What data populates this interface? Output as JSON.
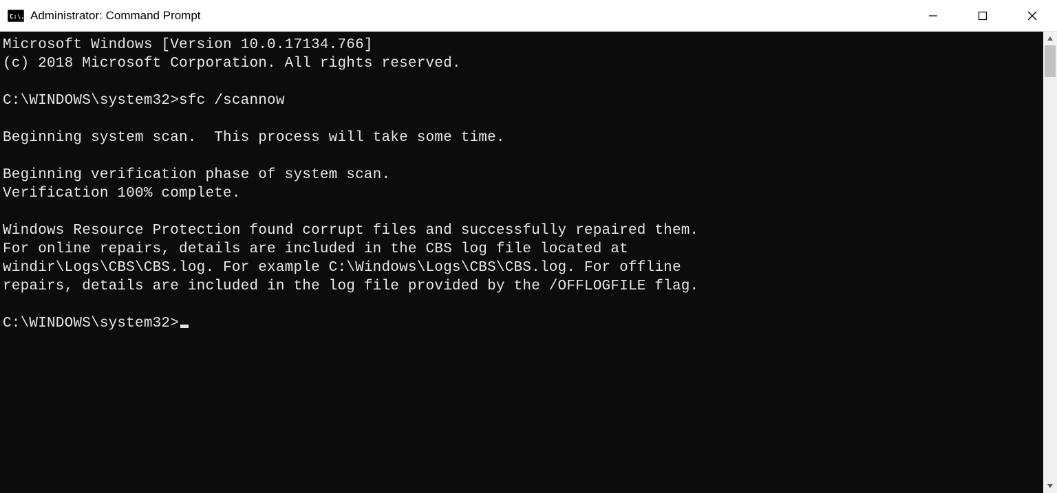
{
  "window": {
    "title": "Administrator: Command Prompt"
  },
  "console": {
    "lines": [
      "Microsoft Windows [Version 10.0.17134.766]",
      "(c) 2018 Microsoft Corporation. All rights reserved.",
      "",
      "C:\\WINDOWS\\system32>sfc /scannow",
      "",
      "Beginning system scan.  This process will take some time.",
      "",
      "Beginning verification phase of system scan.",
      "Verification 100% complete.",
      "",
      "Windows Resource Protection found corrupt files and successfully repaired them.",
      "For online repairs, details are included in the CBS log file located at",
      "windir\\Logs\\CBS\\CBS.log. For example C:\\Windows\\Logs\\CBS\\CBS.log. For offline",
      "repairs, details are included in the log file provided by the /OFFLOGFILE flag.",
      ""
    ],
    "prompt": "C:\\WINDOWS\\system32>"
  }
}
